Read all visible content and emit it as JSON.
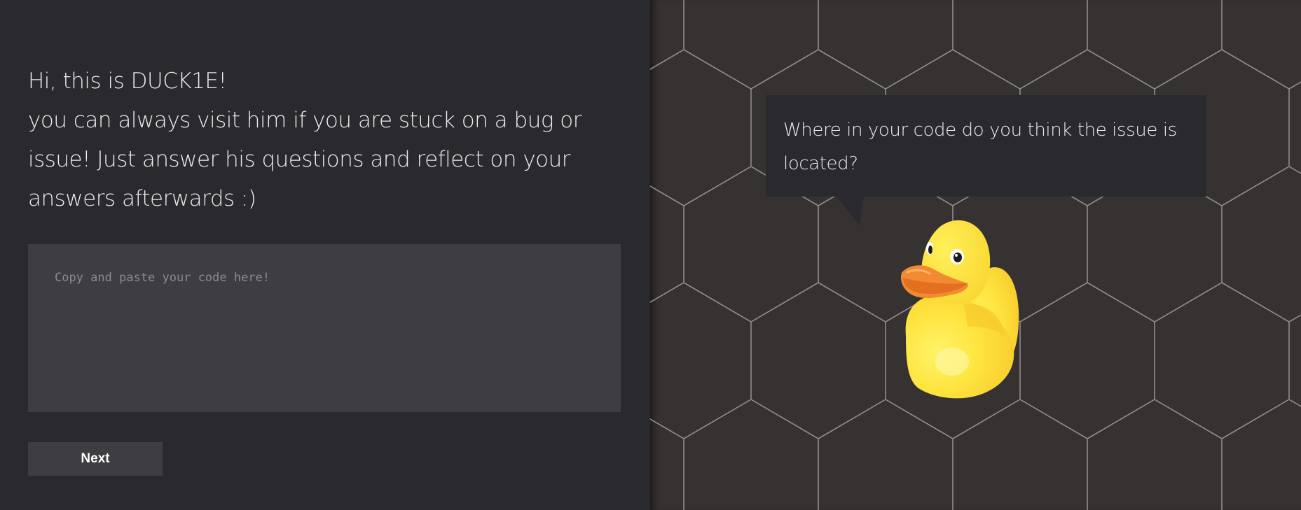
{
  "intro": {
    "greeting": "Hi, this is DUCK1E!",
    "description": "you can always visit him if you are stuck on a bug or issue! Just answer his questions and reflect on your answers afterwards :)"
  },
  "code_input": {
    "placeholder": "Copy and paste your code here!",
    "value": ""
  },
  "next_button": {
    "label": "Next"
  },
  "duck": {
    "question": "Where in your code do you think the issue is located?"
  },
  "colors": {
    "left_bg": "#2a292d",
    "right_bg": "#363232",
    "panel": "#3e3d41",
    "hex_line": "#8f8c8c",
    "duck_yellow": "#ffe13f",
    "beak_orange": "#f7913a"
  },
  "icons": [
    "rubber-duck-icon"
  ]
}
